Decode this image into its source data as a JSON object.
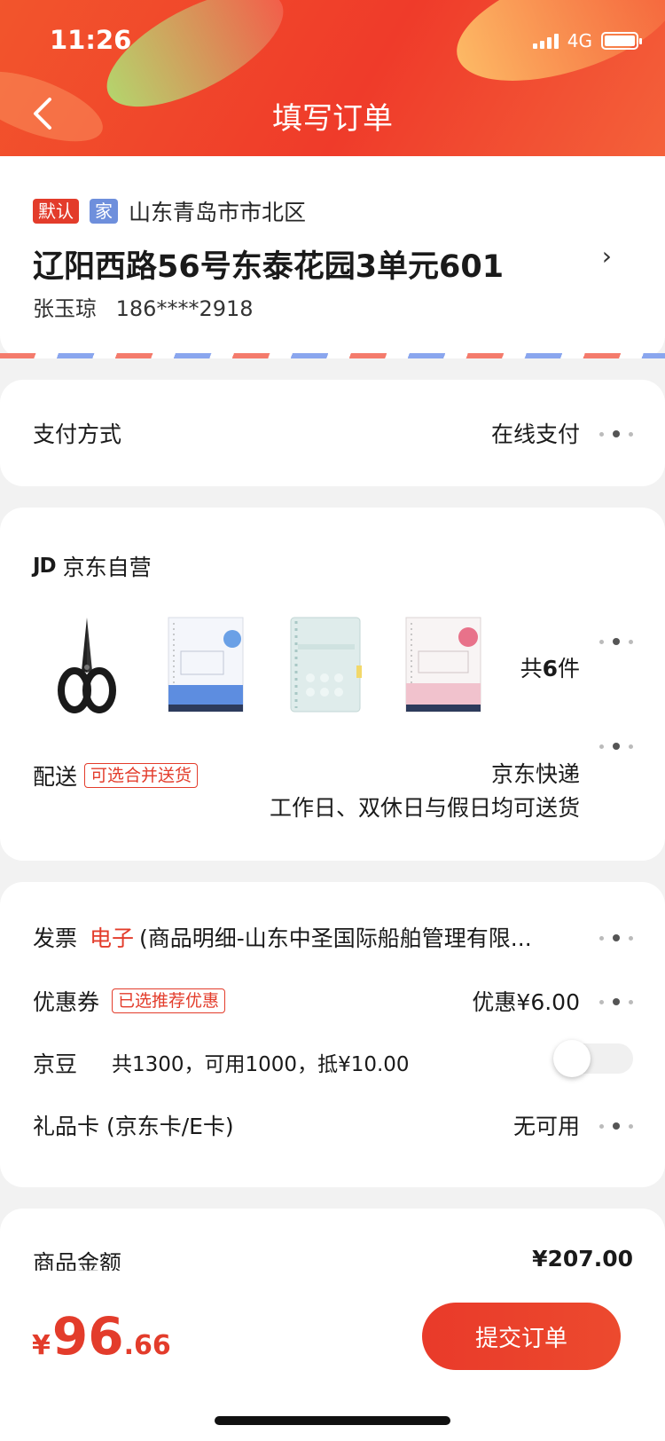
{
  "status_bar": {
    "time": "11:26",
    "network": "4G"
  },
  "header": {
    "title": "填写订单"
  },
  "address": {
    "tags": [
      "默认",
      "家"
    ],
    "region": "山东青岛市市北区",
    "detail": "辽阳西路56号东泰花园3单元601",
    "name": "张玉琼",
    "phone": "186****2918",
    "arrow": "›"
  },
  "payment": {
    "label": "支付方式",
    "value": "在线支付"
  },
  "shop": {
    "logo": "JD",
    "name": "京东自营",
    "products": [
      "scissors-image",
      "b5-campus-loose-leaf-image",
      "binder-folder-image",
      "campus-diary-loose-leaf-image"
    ],
    "count_prefix": "共",
    "count": "6",
    "count_suffix": "件",
    "shipping_label": "配送",
    "shipping_tag": "可选合并送货",
    "shipping_method": "京东快递",
    "shipping_note": "工作日、双休日与假日均可送货"
  },
  "extras": {
    "invoice_label": "发票",
    "invoice_type": "电子",
    "invoice_detail": "(商品明细-山东中圣国际船舶管理有限...",
    "coupon_label": "优惠券",
    "coupon_tag": "已选推荐优惠",
    "coupon_value": "优惠¥6.00",
    "beans_label": "京豆",
    "beans_info": "共1300，可用1000，抵¥10.00",
    "giftcard_label": "礼品卡 (京东卡/E卡)",
    "giftcard_value": "无可用"
  },
  "summary": {
    "goods_amount_label": "商品金额",
    "goods_amount": "¥207.00"
  },
  "bottom": {
    "currency": "¥",
    "total_int": "96",
    "total_dec": ".66",
    "submit_label": "提交订单"
  },
  "colors": {
    "brand_red": "#e33c2b",
    "home_tag_blue": "#6e8fdc"
  }
}
